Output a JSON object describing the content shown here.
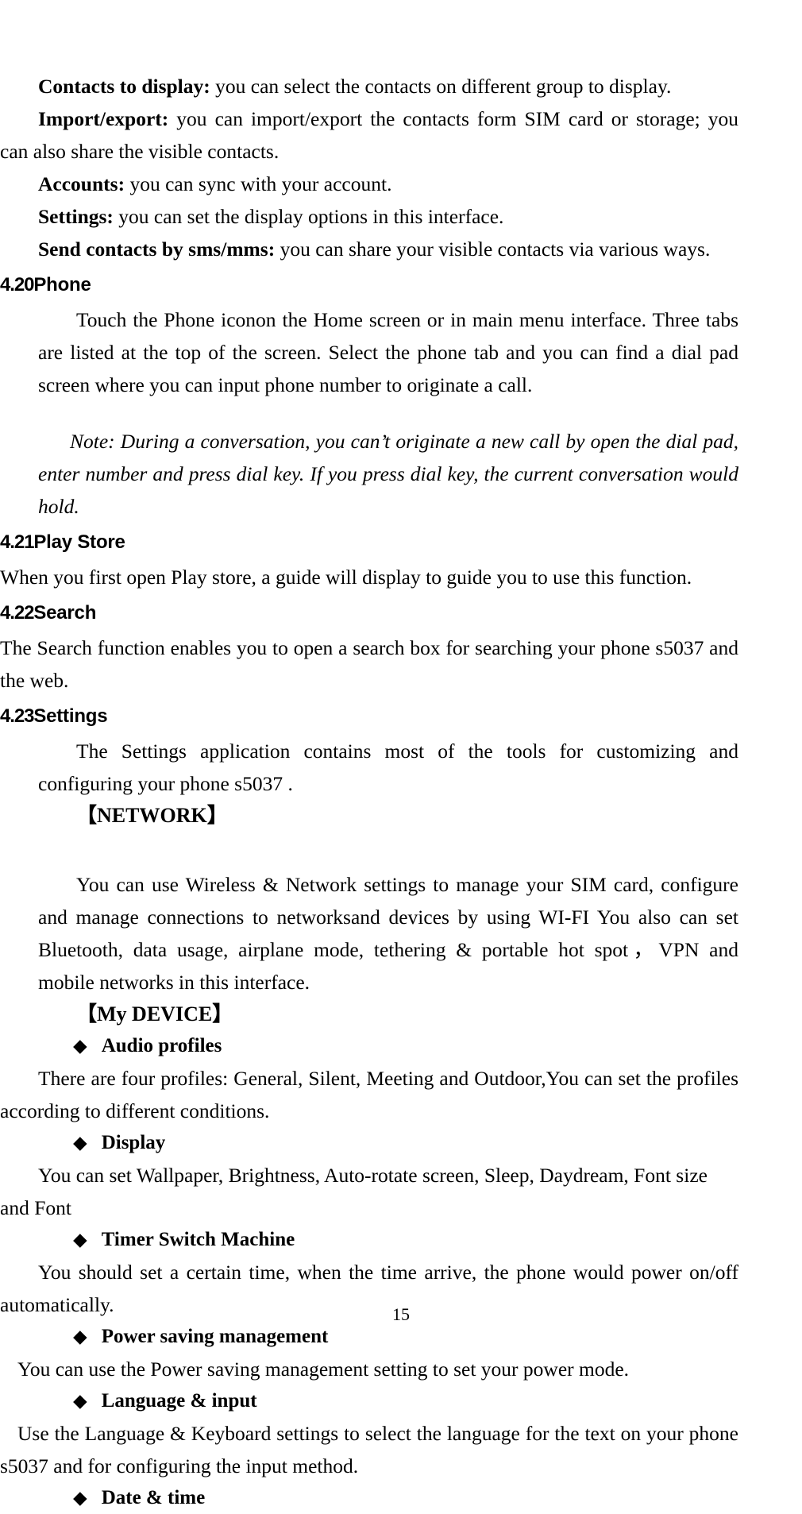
{
  "document": {
    "page_number": "15"
  },
  "contacts_options": [
    {
      "term": "Contacts to display:",
      "text": " you can select the contacts on different group to display."
    },
    {
      "term": "Import/export:",
      "text": " you can import/export the contacts form SIM card or storage; you can also share the visible contacts."
    },
    {
      "term": "Accounts:",
      "text": " you can sync with your account."
    },
    {
      "term": "Settings:",
      "text": " you can set the display options in this interface."
    },
    {
      "term": "Send contacts by sms/mms:",
      "text": " you can share your visible contacts via various ways."
    }
  ],
  "sections": {
    "phone": {
      "number": "4.20",
      "title": "Phone",
      "body": "Touch the Phone iconon the Home screen or in main menu interface. Three tabs are listed at the top of the screen. Select the phone tab and you can find a dial pad screen where you can input phone number to originate a call.",
      "note": "Note: During a conversation, you can’t originate a new call by open the dial pad, enter number and press dial key. If you press dial key, the current conversation would hold."
    },
    "play_store": {
      "number": "4.21",
      "title": "Play Store",
      "body": "When you first open  Play store, a guide will display to guide you to use this function."
    },
    "search": {
      "number": "4.22",
      "title": "Search",
      "body": "The Search function enables you to open a search box for searching your phone s5037   and the web."
    },
    "settings": {
      "number": "4.23",
      "title": "Settings",
      "body": "The Settings application contains most of the tools for customizing and configuring your phone s5037 ."
    }
  },
  "settings_groups": [
    {
      "bracket_open": "【",
      "label": "NETWORK",
      "bracket_close": "】",
      "body": "You can use Wireless & Network settings to manage your SIM card, configure and manage connections to networksand devices by using WI-FI You also can set Bluetooth, data usage, airplane mode, tethering & portable hot spot，VPN and mobile networks in this interface."
    },
    {
      "bracket_open": "【",
      "label": "My DEVICE",
      "bracket_close": "】"
    }
  ],
  "device_items": [
    {
      "bullet": "◆",
      "title": "Audio profiles",
      "body": "There are four profiles: General, Silent, Meeting and Outdoor,You can set the profiles according to different conditions."
    },
    {
      "bullet": "◆",
      "title": "Display",
      "body": "You can set Wallpaper, Brightness, Auto-rotate screen, Sleep, Daydream, Font size and Font"
    },
    {
      "bullet": "◆",
      "title": "Timer Switch Machine",
      "body": "You should set a certain time, when the time arrive, the phone would power on/off automatically."
    },
    {
      "bullet": "◆",
      "title": "Power saving management",
      "body": "You can use the Power saving management setting to set your power mode."
    },
    {
      "bullet": "◆",
      "title": "Language & input",
      "body": "Use the Language & Keyboard settings to select the language for the text on your phone s5037 and for configuring the input method."
    },
    {
      "bullet": "◆",
      "title": "Date & time",
      "body": ""
    }
  ]
}
